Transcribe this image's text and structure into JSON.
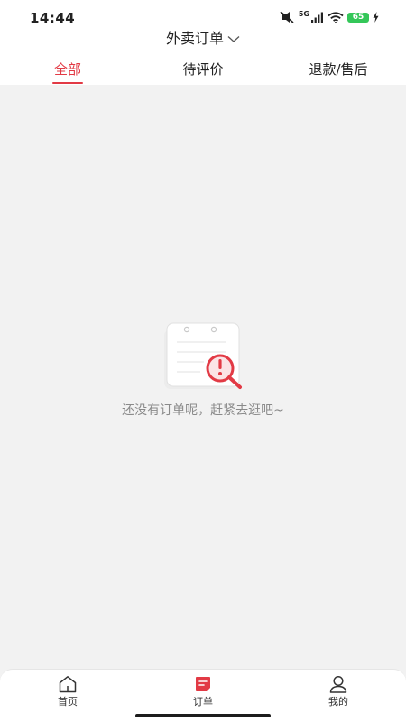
{
  "status_bar": {
    "time": "14:44",
    "network": "5G",
    "battery": "65"
  },
  "header": {
    "title": "外卖订单"
  },
  "tabs": [
    {
      "label": "全部",
      "active": true
    },
    {
      "label": "待评价",
      "active": false
    },
    {
      "label": "退款/售后",
      "active": false
    }
  ],
  "empty_state": {
    "message": "还没有订单呢，赶紧去逛吧~"
  },
  "bottom_nav": [
    {
      "label": "首页",
      "icon": "home-icon",
      "active": false
    },
    {
      "label": "订单",
      "icon": "order-icon",
      "active": true
    },
    {
      "label": "我的",
      "icon": "profile-icon",
      "active": false
    }
  ],
  "colors": {
    "accent": "#e23a45",
    "background": "#f2f2f2",
    "text": "#222222",
    "muted_text": "#8a8a8a"
  }
}
